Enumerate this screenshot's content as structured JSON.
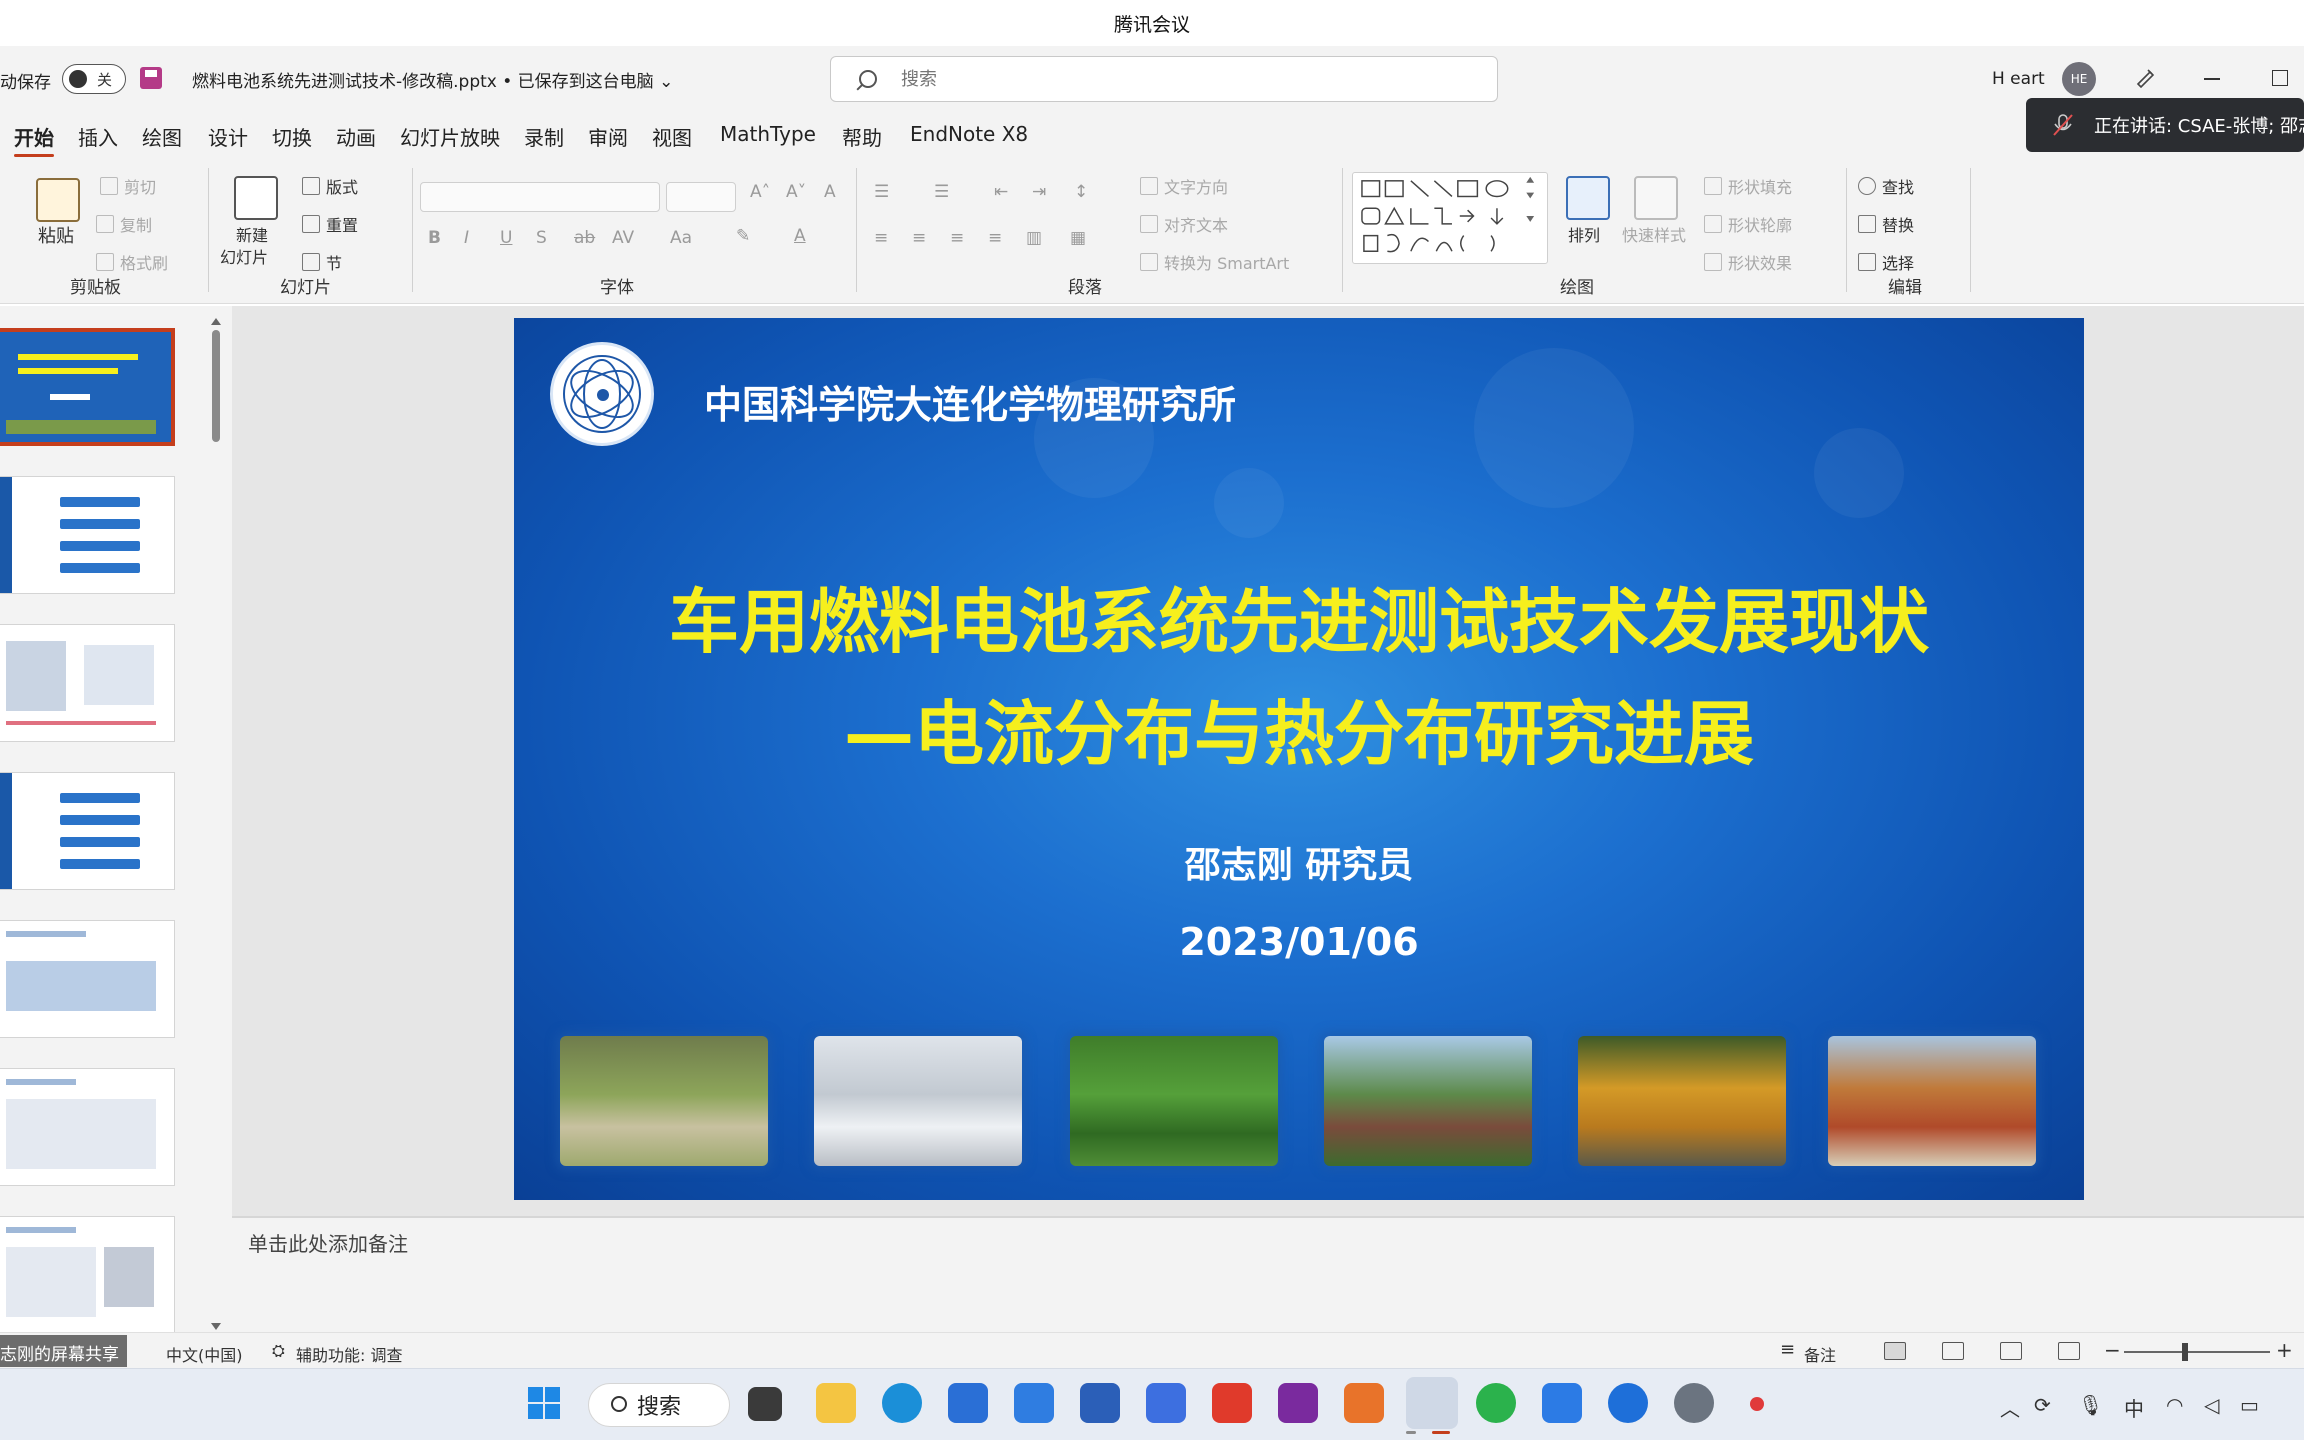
{
  "meeting": {
    "title": "腾讯会议",
    "speaking": "正在讲话: CSAE-张博; 邵志"
  },
  "titlebar": {
    "autosave_label": "动保存",
    "toggle_label": "关",
    "doc_title": "燃料电池系统先进测试技术-修改稿.pptx • 已保存到这台电脑 ⌄",
    "search_placeholder": "搜索",
    "user_name": "H eart",
    "avatar_initials": "HE"
  },
  "tabs": [
    "开始",
    "插入",
    "绘图",
    "设计",
    "切换",
    "动画",
    "幻灯片放映",
    "录制",
    "审阅",
    "视图",
    "MathType",
    "帮助",
    "EndNote X8"
  ],
  "ribbon": {
    "clipboard": {
      "paste": "粘贴",
      "cut": "剪切",
      "copy": "复制",
      "format_painter": "格式刷",
      "label": "剪贴板"
    },
    "slides": {
      "new_slide_line1": "新建",
      "new_slide_line2": "幻灯片",
      "layout": "版式",
      "reset": "重置",
      "section": "节",
      "label": "幻灯片"
    },
    "font": {
      "label": "字体",
      "bold": "B",
      "italic": "I",
      "underline": "U",
      "strike": "S",
      "case": "Aa"
    },
    "paragraph": {
      "text_direction": "文字方向",
      "align_text": "对齐文本",
      "smartart": "转换为 SmartArt",
      "label": "段落"
    },
    "drawing": {
      "arrange": "排列",
      "quick_styles": "快速样式",
      "fill": "形状填充",
      "outline": "形状轮廓",
      "effects": "形状效果",
      "label": "绘图"
    },
    "editing": {
      "find": "查找",
      "replace": "替换",
      "select": "选择",
      "label": "编辑"
    }
  },
  "slide": {
    "institute": "中国科学院大连化学物理研究所",
    "title_line1": "车用燃料电池系统先进测试技术发展现状",
    "title_line2": "—电流分布与热分布研究进展",
    "author": "邵志刚 研究员",
    "date": "2023/01/06"
  },
  "notes_placeholder": "单击此处添加备注",
  "status": {
    "share_tag": "志刚的屏幕共享",
    "language": "中文(中国)",
    "accessibility": "辅助功能: 调查",
    "notes": "备注",
    "zoom_minus": "−",
    "zoom_plus": "+"
  },
  "taskbar": {
    "search": "搜索",
    "ime": "中"
  },
  "colors": {
    "accent": "#c43e1c",
    "slide_blue": "#1c6fcf",
    "title_yellow": "#f6ef1d"
  }
}
